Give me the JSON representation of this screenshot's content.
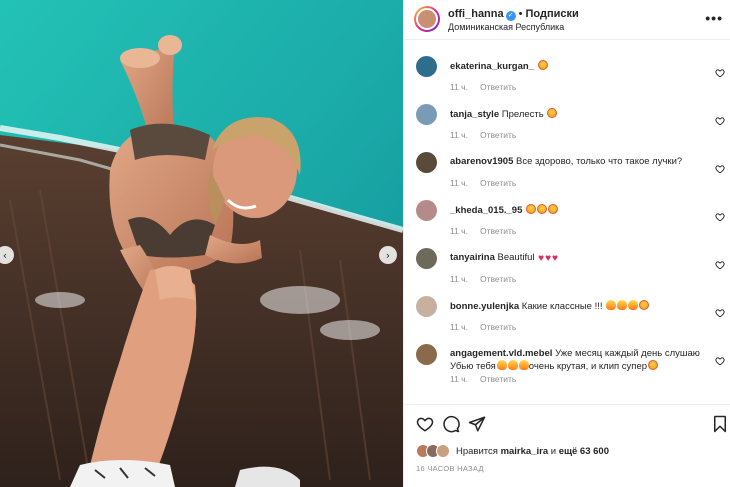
{
  "header": {
    "username": "offi_hanna",
    "verified_icon": "verified-badge-icon",
    "separator": "•",
    "follow_label": "Подписки",
    "location": "Доминиканская Республика",
    "more_icon": "•••"
  },
  "photo": {
    "prev_icon": "‹",
    "next_icon": "›"
  },
  "comments": [
    {
      "user": "ekaterina_kurgan_",
      "text": "",
      "emoji": [
        "smile"
      ],
      "time": "11 ч.",
      "reply": "Ответить",
      "avatar_color": "#2f6d8c"
    },
    {
      "user": "tanja_style",
      "text": "Прелесть",
      "emoji": [
        "smile"
      ],
      "time": "11 ч.",
      "reply": "Ответить",
      "avatar_color": "#7a9bb8"
    },
    {
      "user": "abarenov1905",
      "text": "Все здорово, только что такое лучки?",
      "emoji": [],
      "time": "11 ч.",
      "reply": "Ответить",
      "avatar_color": "#5a4a3a"
    },
    {
      "user": "_kheda_015._95",
      "text": "",
      "emoji": [
        "smile",
        "smile",
        "smile"
      ],
      "time": "11 ч.",
      "reply": "Ответить",
      "avatar_color": "#b58a8a"
    },
    {
      "user": "tanyairina",
      "text": "Beautiful",
      "emoji": [
        "heart",
        "heart",
        "heart"
      ],
      "time": "11 ч.",
      "reply": "Ответить",
      "avatar_color": "#6e6a5a"
    },
    {
      "user": "bonne.yulenjka",
      "text": "Какие классные !!!",
      "emoji": [
        "fire",
        "fire",
        "fire",
        "smile"
      ],
      "time": "11 ч.",
      "reply": "Ответить",
      "avatar_color": "#c8b0a0"
    },
    {
      "user": "angagement.vld.mebel",
      "text": "Уже месяц каждый день слушаю",
      "text2a": "Убью тебя",
      "text2b": "очень крутая, и клип супер",
      "emoji": [],
      "time": "11 ч.",
      "reply": "Ответить",
      "avatar_color": "#8a6a4a"
    }
  ],
  "actions": {
    "like_icon": "heart-outline-icon",
    "comment_icon": "comment-icon",
    "share_icon": "share-icon",
    "save_icon": "bookmark-icon",
    "likes_prefix": "Нравится",
    "likes_user": "mairka_ira",
    "likes_middle": "и",
    "likes_count": "ещё 63 600",
    "time_ago": "16 ЧАСОВ НАЗАД"
  },
  "colors": {
    "accent_blue": "#3897f0",
    "text": "#262626",
    "muted": "#8e8e8e",
    "water": "#1fb5b0",
    "deck": "#4a3529"
  }
}
